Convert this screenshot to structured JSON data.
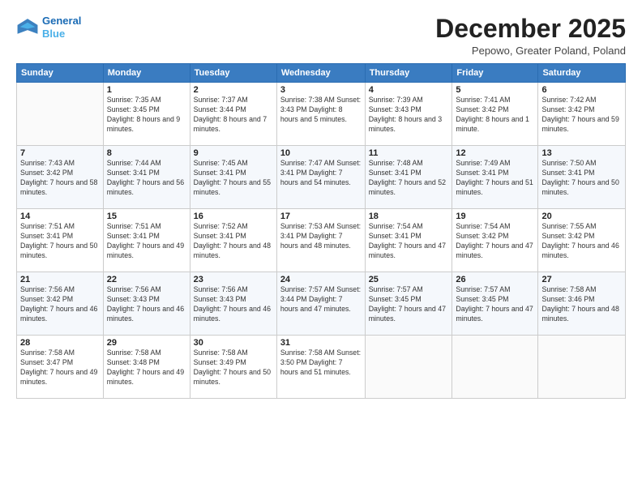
{
  "header": {
    "logo_line1": "General",
    "logo_line2": "Blue",
    "title": "December 2025",
    "subtitle": "Pepowo, Greater Poland, Poland"
  },
  "days": [
    "Sunday",
    "Monday",
    "Tuesday",
    "Wednesday",
    "Thursday",
    "Friday",
    "Saturday"
  ],
  "weeks": [
    [
      {
        "date": "",
        "content": ""
      },
      {
        "date": "1",
        "content": "Sunrise: 7:35 AM\nSunset: 3:45 PM\nDaylight: 8 hours\nand 9 minutes."
      },
      {
        "date": "2",
        "content": "Sunrise: 7:37 AM\nSunset: 3:44 PM\nDaylight: 8 hours\nand 7 minutes."
      },
      {
        "date": "3",
        "content": "Sunrise: 7:38 AM\nSunset: 3:43 PM\nDaylight: 8 hours\nand 5 minutes."
      },
      {
        "date": "4",
        "content": "Sunrise: 7:39 AM\nSunset: 3:43 PM\nDaylight: 8 hours\nand 3 minutes."
      },
      {
        "date": "5",
        "content": "Sunrise: 7:41 AM\nSunset: 3:42 PM\nDaylight: 8 hours\nand 1 minute."
      },
      {
        "date": "6",
        "content": "Sunrise: 7:42 AM\nSunset: 3:42 PM\nDaylight: 7 hours\nand 59 minutes."
      }
    ],
    [
      {
        "date": "7",
        "content": "Sunrise: 7:43 AM\nSunset: 3:42 PM\nDaylight: 7 hours\nand 58 minutes."
      },
      {
        "date": "8",
        "content": "Sunrise: 7:44 AM\nSunset: 3:41 PM\nDaylight: 7 hours\nand 56 minutes."
      },
      {
        "date": "9",
        "content": "Sunrise: 7:45 AM\nSunset: 3:41 PM\nDaylight: 7 hours\nand 55 minutes."
      },
      {
        "date": "10",
        "content": "Sunrise: 7:47 AM\nSunset: 3:41 PM\nDaylight: 7 hours\nand 54 minutes."
      },
      {
        "date": "11",
        "content": "Sunrise: 7:48 AM\nSunset: 3:41 PM\nDaylight: 7 hours\nand 52 minutes."
      },
      {
        "date": "12",
        "content": "Sunrise: 7:49 AM\nSunset: 3:41 PM\nDaylight: 7 hours\nand 51 minutes."
      },
      {
        "date": "13",
        "content": "Sunrise: 7:50 AM\nSunset: 3:41 PM\nDaylight: 7 hours\nand 50 minutes."
      }
    ],
    [
      {
        "date": "14",
        "content": "Sunrise: 7:51 AM\nSunset: 3:41 PM\nDaylight: 7 hours\nand 50 minutes."
      },
      {
        "date": "15",
        "content": "Sunrise: 7:51 AM\nSunset: 3:41 PM\nDaylight: 7 hours\nand 49 minutes."
      },
      {
        "date": "16",
        "content": "Sunrise: 7:52 AM\nSunset: 3:41 PM\nDaylight: 7 hours\nand 48 minutes."
      },
      {
        "date": "17",
        "content": "Sunrise: 7:53 AM\nSunset: 3:41 PM\nDaylight: 7 hours\nand 48 minutes."
      },
      {
        "date": "18",
        "content": "Sunrise: 7:54 AM\nSunset: 3:41 PM\nDaylight: 7 hours\nand 47 minutes."
      },
      {
        "date": "19",
        "content": "Sunrise: 7:54 AM\nSunset: 3:42 PM\nDaylight: 7 hours\nand 47 minutes."
      },
      {
        "date": "20",
        "content": "Sunrise: 7:55 AM\nSunset: 3:42 PM\nDaylight: 7 hours\nand 46 minutes."
      }
    ],
    [
      {
        "date": "21",
        "content": "Sunrise: 7:56 AM\nSunset: 3:42 PM\nDaylight: 7 hours\nand 46 minutes."
      },
      {
        "date": "22",
        "content": "Sunrise: 7:56 AM\nSunset: 3:43 PM\nDaylight: 7 hours\nand 46 minutes."
      },
      {
        "date": "23",
        "content": "Sunrise: 7:56 AM\nSunset: 3:43 PM\nDaylight: 7 hours\nand 46 minutes."
      },
      {
        "date": "24",
        "content": "Sunrise: 7:57 AM\nSunset: 3:44 PM\nDaylight: 7 hours\nand 47 minutes."
      },
      {
        "date": "25",
        "content": "Sunrise: 7:57 AM\nSunset: 3:45 PM\nDaylight: 7 hours\nand 47 minutes."
      },
      {
        "date": "26",
        "content": "Sunrise: 7:57 AM\nSunset: 3:45 PM\nDaylight: 7 hours\nand 47 minutes."
      },
      {
        "date": "27",
        "content": "Sunrise: 7:58 AM\nSunset: 3:46 PM\nDaylight: 7 hours\nand 48 minutes."
      }
    ],
    [
      {
        "date": "28",
        "content": "Sunrise: 7:58 AM\nSunset: 3:47 PM\nDaylight: 7 hours\nand 49 minutes."
      },
      {
        "date": "29",
        "content": "Sunrise: 7:58 AM\nSunset: 3:48 PM\nDaylight: 7 hours\nand 49 minutes."
      },
      {
        "date": "30",
        "content": "Sunrise: 7:58 AM\nSunset: 3:49 PM\nDaylight: 7 hours\nand 50 minutes."
      },
      {
        "date": "31",
        "content": "Sunrise: 7:58 AM\nSunset: 3:50 PM\nDaylight: 7 hours\nand 51 minutes."
      },
      {
        "date": "",
        "content": ""
      },
      {
        "date": "",
        "content": ""
      },
      {
        "date": "",
        "content": ""
      }
    ]
  ]
}
